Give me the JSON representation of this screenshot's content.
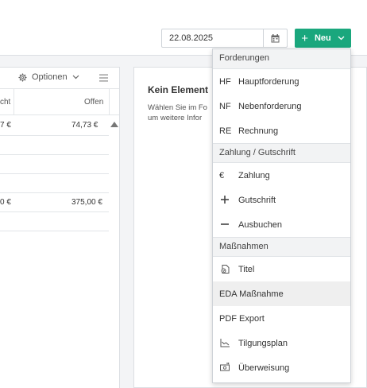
{
  "toolbar": {
    "date_value": "22.08.2025",
    "new_button_label": "Neu"
  },
  "left_panel": {
    "options_label": "Optionen",
    "col_headers": [
      "cht",
      "Offen"
    ],
    "rows": [
      {
        "a": "7 €",
        "b": "74,73 €"
      },
      {
        "a": "0 €",
        "b": "375,00 €"
      }
    ]
  },
  "right_panel": {
    "title": "Kein Element",
    "desc_line1": "Wählen Sie im Fo",
    "desc_line2": "um weitere Infor"
  },
  "dropdown": {
    "sections": [
      {
        "header": "Forderungen",
        "items": [
          {
            "abbr": "HF",
            "label": "Hauptforderung"
          },
          {
            "abbr": "NF",
            "label": "Nebenforderung"
          },
          {
            "abbr": "RE",
            "label": "Rechnung"
          }
        ]
      },
      {
        "header": "Zahlung / Gutschrift",
        "items": [
          {
            "abbr": "€",
            "label": "Zahlung"
          },
          {
            "icon": "plus-icon",
            "label": "Gutschrift"
          },
          {
            "icon": "minus-icon",
            "label": "Ausbuchen"
          }
        ]
      },
      {
        "header": "Maßnahmen",
        "items": [
          {
            "icon": "title-document-icon",
            "label": "Titel"
          },
          {
            "label": "EDA Maßnahme"
          },
          {
            "label": "PDF Export"
          },
          {
            "icon": "chart-icon",
            "label": "Tilgungsplan"
          },
          {
            "icon": "money-transfer-icon",
            "label": "Überweisung"
          }
        ]
      }
    ]
  },
  "colors": {
    "accent": "#1aa77d"
  }
}
